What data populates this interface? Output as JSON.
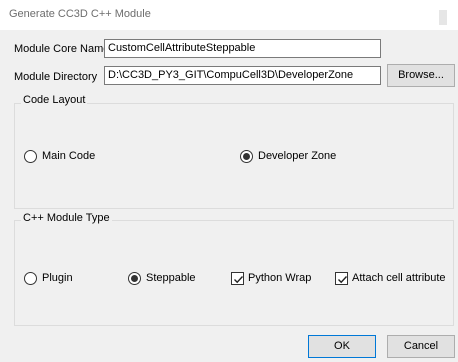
{
  "window": {
    "title": "Generate CC3D C++ Module"
  },
  "form": {
    "core_name_label": "Module Core Name",
    "core_name_value": "CustomCellAttributeSteppable",
    "directory_label": "Module Directory",
    "directory_value": "D:\\CC3D_PY3_GIT\\CompuCell3D\\DeveloperZone",
    "browse_label": "Browse..."
  },
  "code_layout": {
    "title": "Code Layout",
    "options": [
      {
        "label": "Main Code",
        "checked": false
      },
      {
        "label": "Developer Zone",
        "checked": true
      }
    ]
  },
  "module_type": {
    "title": "C++ Module Type",
    "options": [
      {
        "label": "Plugin",
        "checked": false
      },
      {
        "label": "Steppable",
        "checked": true
      }
    ],
    "checkboxes": [
      {
        "label": "Python Wrap",
        "checked": true
      },
      {
        "label": "Attach cell attribute",
        "checked": true
      }
    ]
  },
  "footer": {
    "ok_label": "OK",
    "cancel_label": "Cancel"
  }
}
